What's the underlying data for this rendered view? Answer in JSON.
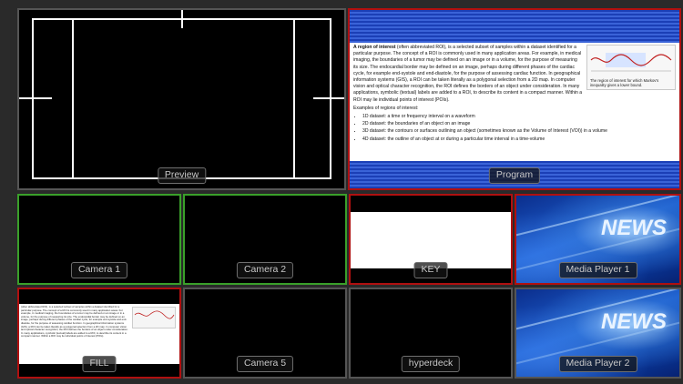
{
  "tiles": {
    "preview": "Preview",
    "program": "Program",
    "camera1": "Camera 1",
    "camera2": "Camera 2",
    "key": "KEY",
    "media1": "Media Player 1",
    "fill": "FILL",
    "camera5": "Camera 5",
    "hyperdeck": "hyperdeck",
    "media2": "Media Player 2"
  },
  "news": {
    "text": "NEWS"
  },
  "colors": {
    "program_tally": "#b01010",
    "preview_tally": "#3aa02a",
    "border_default": "#555555"
  },
  "wiki": {
    "intro_bold": "A region of interest",
    "intro": " (often abbreviated ROI), is a selected subset of samples within a dataset identified for a particular purpose. The concept of a ROI is commonly used in many application areas. For example, in medical imaging, the boundaries of a tumor may be defined on an image or in a volume, for the purpose of measuring its size. The endocardial border may be defined on an image, perhaps during different phases of the cardiac cycle, for example end-systole and end-diastole, for the purpose of assessing cardiac function. In geographical information systems (GIS), a ROI can be taken literally as a polygonal selection from a 2D map. In computer vision and optical character recognition, the ROI defines the borders of an object under consideration. In many applications, symbolic (textual) labels are added to a ROI, to describe its content in a compact manner. Within a ROI may lie individual points of interest (POIs).",
    "examples_heading": "Examples of regions of interest:",
    "examples": [
      "1D dataset: a time or frequency interval on a waveform",
      "2D dataset: the boundaries of an object on an image",
      "3D dataset: the contours or surfaces outlining an object (sometimes known as the Volume of Interest (VOI)) in a volume",
      "4D dataset: the outline of an object at or during a particular time interval in a time-volume"
    ],
    "thumb_caption": "The region of interest for which Markov's inequality gives a lower bound."
  }
}
